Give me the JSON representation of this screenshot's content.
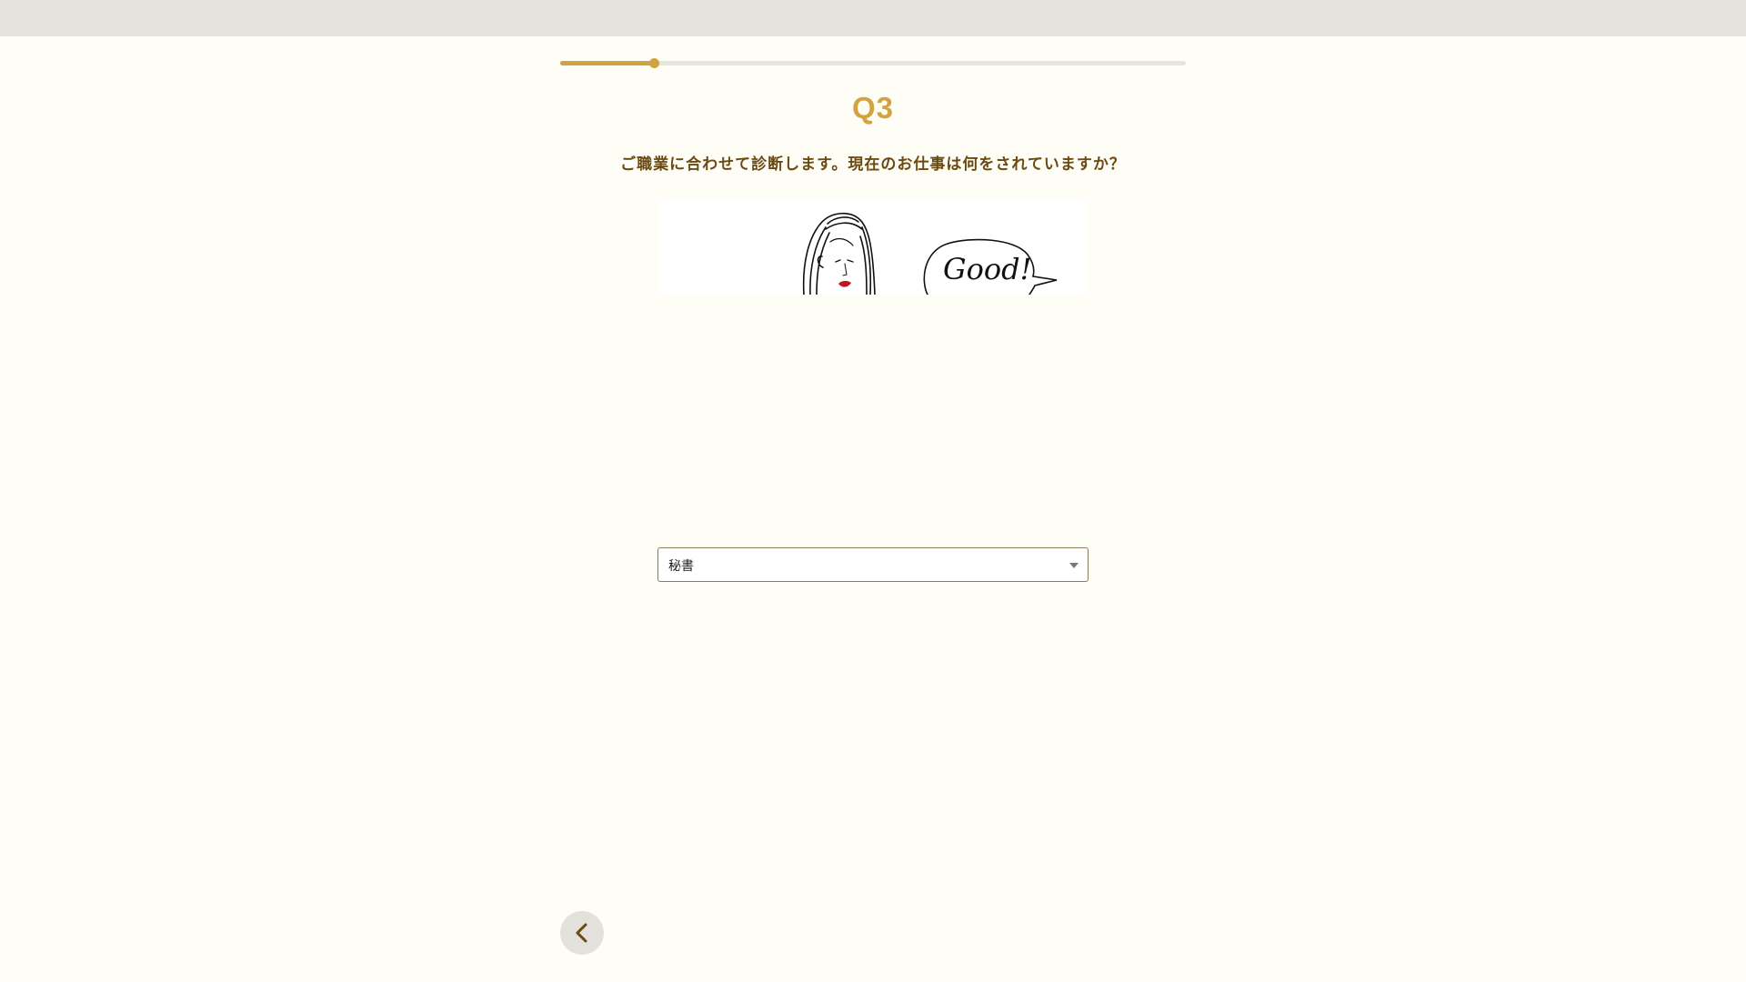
{
  "progress": {
    "value": 0.15
  },
  "question": {
    "number": "Q3",
    "text": "ご職業に合わせて診断します。現在のお仕事は何をされていますか？"
  },
  "illustration": {
    "bubble_text": "Good!"
  },
  "occupation_select": {
    "selected": "秘書"
  },
  "colors": {
    "accent": "#d3a33f",
    "question_text": "#6b4a12",
    "background": "#fefef6",
    "lipstick": "#c0151d"
  },
  "icons": {
    "back": "chevron-left-icon",
    "dropdown": "caret-down-icon"
  }
}
